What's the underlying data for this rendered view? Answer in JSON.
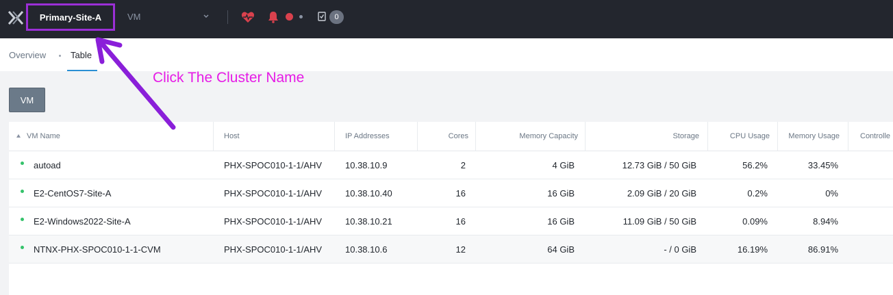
{
  "topbar": {
    "logo_icon": "nutanix-x-logo-icon",
    "cluster_name": "Primary-Site-A",
    "entity_select": "VM",
    "icons": [
      "health-heart-icon",
      "alert-bell-icon",
      "tasks-checklist-icon"
    ],
    "task_count": "0"
  },
  "subnav": {
    "tabs": [
      {
        "label": "Overview",
        "active": false
      },
      {
        "label": "Table",
        "active": true
      }
    ]
  },
  "toolbar": {
    "vm_button": "VM"
  },
  "table": {
    "columns": [
      "VM Name",
      "Host",
      "IP Addresses",
      "Cores",
      "Memory Capacity",
      "Storage",
      "CPU Usage",
      "Memory Usage",
      "Controlle"
    ],
    "rows": [
      {
        "name": "autoad",
        "host": "PHX-SPOC010-1-1/AHV",
        "ip": "10.38.10.9",
        "cores": "2",
        "memory": "4 GiB",
        "storage": "12.73 GiB / 50 GiB",
        "cpu": "56.2%",
        "mem_usage": "33.45%",
        "status": "on"
      },
      {
        "name": "E2-CentOS7-Site-A",
        "host": "PHX-SPOC010-1-1/AHV",
        "ip": "10.38.10.40",
        "cores": "16",
        "memory": "16 GiB",
        "storage": "2.09 GiB / 20 GiB",
        "cpu": "0.2%",
        "mem_usage": "0%",
        "status": "on"
      },
      {
        "name": "E2-Windows2022-Site-A",
        "host": "PHX-SPOC010-1-1/AHV",
        "ip": "10.38.10.21",
        "cores": "16",
        "memory": "16 GiB",
        "storage": "11.09 GiB / 50 GiB",
        "cpu": "0.09%",
        "mem_usage": "8.94%",
        "status": "on"
      },
      {
        "name": "NTNX-PHX-SPOC010-1-1-CVM",
        "host": "PHX-SPOC010-1-1/AHV",
        "ip": "10.38.10.6",
        "cores": "12",
        "memory": "64 GiB",
        "storage": "- / 0 GiB",
        "cpu": "16.19%",
        "mem_usage": "86.91%",
        "status": "on"
      }
    ]
  },
  "annotation": {
    "text": "Click The Cluster Name",
    "color": "#e61be6",
    "highlight_color": "#9b2fd6"
  }
}
